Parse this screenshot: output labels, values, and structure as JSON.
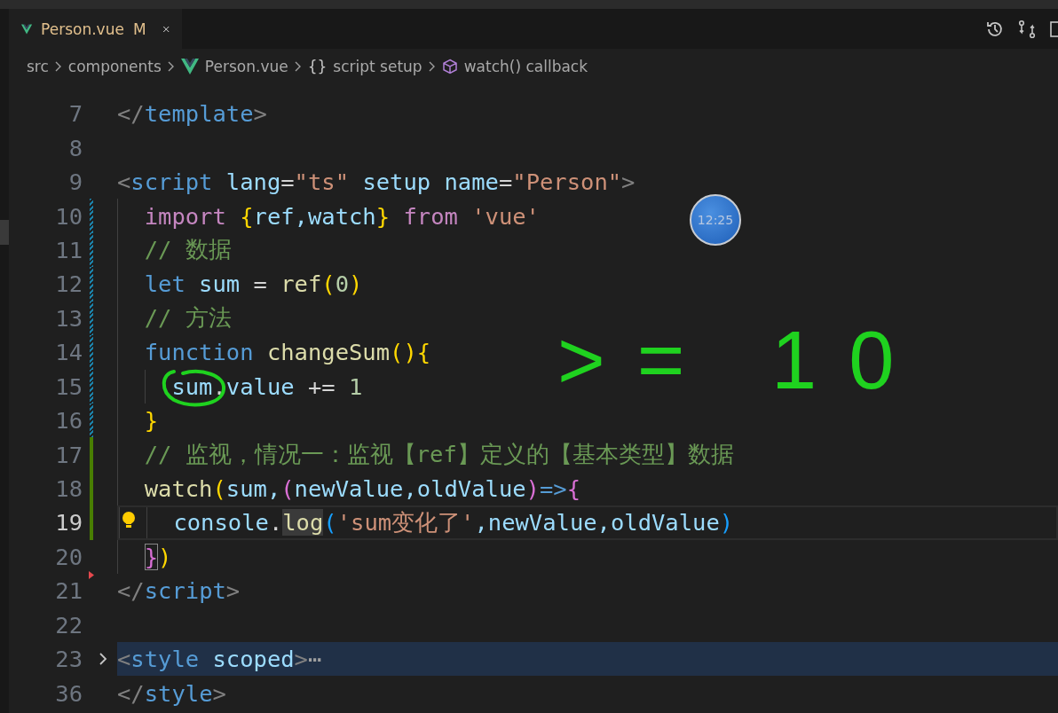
{
  "tabs": [
    {
      "label": "Person.vue",
      "status": "M",
      "selected": true
    }
  ],
  "breadcrumb": [
    {
      "label": "src",
      "kind": "folder"
    },
    {
      "label": "components",
      "kind": "folder"
    },
    {
      "label": "Person.vue",
      "kind": "file"
    },
    {
      "label": "script setup",
      "kind": "block",
      "symbol": "{}"
    },
    {
      "label": "watch() callback",
      "kind": "method"
    }
  ],
  "lines": [
    {
      "number": "7",
      "kind": "plain",
      "current": false,
      "folded": false,
      "tokens": [
        {
          "text": "</",
          "kind": "punct"
        },
        {
          "text": "template",
          "kind": "tag"
        },
        {
          "text": ">",
          "kind": "punct"
        }
      ]
    },
    {
      "number": "8",
      "kind": "plain",
      "current": false,
      "folded": false
    },
    {
      "number": "9",
      "kind": "plain",
      "current": false,
      "folded": false,
      "tokens": [
        {
          "text": "<",
          "kind": "punct"
        },
        {
          "text": "script",
          "kind": "tag"
        },
        {
          "text": " lang",
          "kind": "attr"
        },
        {
          "text": "=",
          "kind": "op"
        },
        {
          "text": "\"ts\"",
          "kind": "str"
        },
        {
          "text": " setup name",
          "kind": "attr"
        },
        {
          "text": "=",
          "kind": "op"
        },
        {
          "text": "\"Person\"",
          "kind": "str"
        },
        {
          "text": ">",
          "kind": "punct"
        }
      ]
    },
    {
      "number": "10",
      "kind": "modified",
      "current": false,
      "folded": false,
      "tokens": [
        {
          "text": "  import",
          "kind": "kw"
        },
        {
          "text": " {",
          "kind": "brace1"
        },
        {
          "text": "ref,watch",
          "kind": "var"
        },
        {
          "text": "}",
          "kind": "brace1"
        },
        {
          "text": " from",
          "kind": "kw"
        },
        {
          "text": " 'vue'",
          "kind": "str"
        }
      ]
    },
    {
      "number": "11",
      "kind": "modified",
      "current": false,
      "folded": false,
      "tokens": [
        {
          "text": "  // 数据",
          "kind": "comment"
        }
      ]
    },
    {
      "number": "12",
      "kind": "modified",
      "current": false,
      "folded": false,
      "tokens": [
        {
          "text": "  let",
          "kind": "decl"
        },
        {
          "text": " sum",
          "kind": "var"
        },
        {
          "text": " = ",
          "kind": "op"
        },
        {
          "text": "ref",
          "kind": "fn"
        },
        {
          "text": "(",
          "kind": "brace1"
        },
        {
          "text": "0",
          "kind": "num"
        },
        {
          "text": ")",
          "kind": "brace1"
        }
      ]
    },
    {
      "number": "13",
      "kind": "modified",
      "current": false,
      "folded": false,
      "tokens": [
        {
          "text": "  // 方法",
          "kind": "comment"
        }
      ]
    },
    {
      "number": "14",
      "kind": "modified",
      "current": false,
      "folded": false,
      "tokens": [
        {
          "text": "  function",
          "kind": "decl"
        },
        {
          "text": " changeSum",
          "kind": "fn"
        },
        {
          "text": "(){",
          "kind": "brace1"
        }
      ]
    },
    {
      "number": "15",
      "kind": "modified",
      "current": false,
      "folded": false,
      "tokens": [
        {
          "text": "    sum",
          "kind": "var"
        },
        {
          "text": ".",
          "kind": "op"
        },
        {
          "text": "value",
          "kind": "var"
        },
        {
          "text": " += ",
          "kind": "op"
        },
        {
          "text": "1",
          "kind": "num"
        }
      ]
    },
    {
      "number": "16",
      "kind": "modified",
      "current": false,
      "folded": false,
      "tokens": [
        {
          "text": "  }",
          "kind": "brace1"
        }
      ]
    },
    {
      "number": "17",
      "kind": "added",
      "current": false,
      "folded": false,
      "tokens": [
        {
          "text": "  // 监视，情况一：监视【ref】定义的【基本类型】数据",
          "kind": "comment"
        }
      ]
    },
    {
      "number": "18",
      "kind": "added",
      "current": false,
      "folded": false,
      "tokens": [
        {
          "text": "  watch",
          "kind": "fn"
        },
        {
          "text": "(",
          "kind": "brace1"
        },
        {
          "text": "sum,",
          "kind": "var"
        },
        {
          "text": "(",
          "kind": "brace2"
        },
        {
          "text": "newValue,oldValue",
          "kind": "var"
        },
        {
          "text": ")",
          "kind": "brace2"
        },
        {
          "text": "=>",
          "kind": "decl"
        },
        {
          "text": "{",
          "kind": "brace2"
        }
      ]
    },
    {
      "number": "19",
      "kind": "added",
      "current": true,
      "folded": false,
      "lightbulb": true,
      "tokens": [
        {
          "text": "    console",
          "kind": "var"
        },
        {
          "text": ".",
          "kind": "op"
        },
        {
          "text": "log",
          "kind": "fn-hl"
        },
        {
          "text": "(",
          "kind": "brace3"
        },
        {
          "text": "'sum变化了'",
          "kind": "str"
        },
        {
          "text": ",newValue,oldValue",
          "kind": "var"
        },
        {
          "text": ")",
          "kind": "brace3"
        }
      ]
    },
    {
      "number": "20",
      "kind": "plain",
      "current": false,
      "folded": false,
      "error_marker": true,
      "tokens": [
        {
          "text": "  }",
          "kind": "brace2-match"
        },
        {
          "text": ")",
          "kind": "brace1"
        }
      ]
    },
    {
      "number": "21",
      "kind": "plain",
      "current": false,
      "folded": false,
      "tokens": [
        {
          "text": "</",
          "kind": "punct"
        },
        {
          "text": "script",
          "kind": "tag"
        },
        {
          "text": ">",
          "kind": "punct"
        }
      ]
    },
    {
      "number": "22",
      "kind": "plain",
      "current": false,
      "folded": false
    },
    {
      "number": "23",
      "kind": "plain",
      "current": false,
      "folded": true,
      "tokens": [
        {
          "text": "<",
          "kind": "punct"
        },
        {
          "text": "style",
          "kind": "tag"
        },
        {
          "text": " scoped",
          "kind": "attr"
        },
        {
          "text": ">",
          "kind": "punct"
        },
        {
          "text": "⋯",
          "kind": "fold"
        }
      ]
    },
    {
      "number": "36",
      "kind": "plain",
      "current": false,
      "folded": false,
      "tokens": [
        {
          "text": "</",
          "kind": "punct"
        },
        {
          "text": "style",
          "kind": "tag"
        },
        {
          "text": ">",
          "kind": "punct"
        }
      ]
    }
  ],
  "overlay_clock": {
    "time": "12:25"
  },
  "annotation": {
    "text": ">= 10"
  }
}
